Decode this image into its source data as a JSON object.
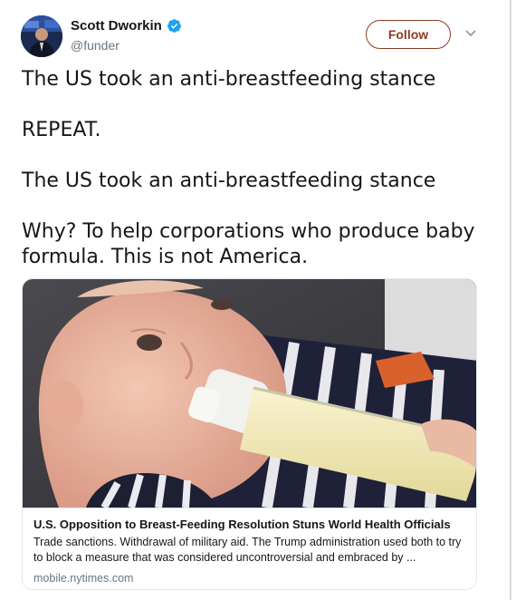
{
  "author": {
    "display_name": "Scott Dworkin",
    "handle": "@funder"
  },
  "follow_label": "Follow",
  "tweet": {
    "paragraphs": [
      "The US took an anti-breastfeeding stance",
      "REPEAT.",
      "The US took an anti-breastfeeding stance",
      "Why? To help corporations who produce baby formula. This is not America."
    ]
  },
  "card": {
    "title": "U.S. Opposition to Breast-Feeding Resolution Stuns World Health Officials",
    "description": "Trade sanctions. Withdrawal of military aid. The Trump administration used both to try to block a measure that was considered uncontroversial and embraced by ...",
    "domain": "mobile.nytimes.com"
  },
  "colors": {
    "follow_accent": "#8c3b22",
    "verified": "#1da1f2",
    "secondary_text": "#657786",
    "border": "#e1e8ed"
  },
  "icons": [
    "verified-badge-icon",
    "caret-down-icon"
  ]
}
